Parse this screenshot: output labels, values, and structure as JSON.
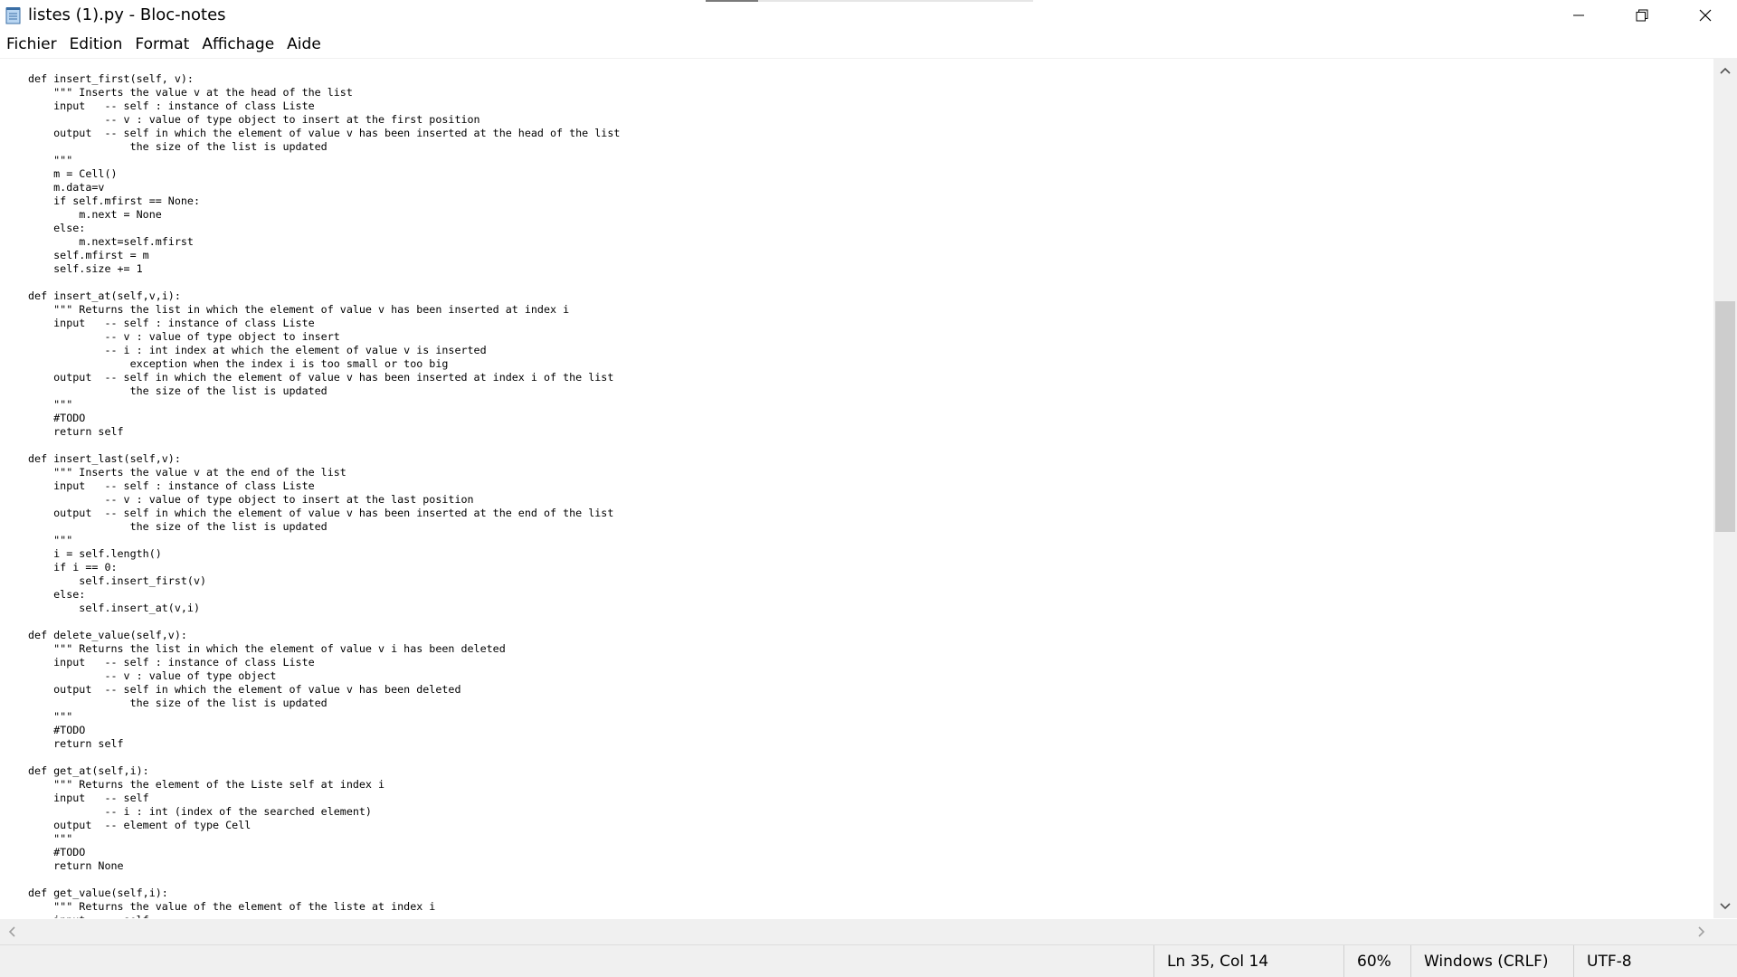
{
  "window": {
    "title": "listes (1).py - Bloc-notes",
    "icon": "notepad-icon",
    "controls": [
      "minimize-icon",
      "restore-icon",
      "close-icon"
    ],
    "loading_progress": 0.16
  },
  "menu": {
    "items": [
      "Fichier",
      "Edition",
      "Format",
      "Affichage",
      "Aide"
    ]
  },
  "editor": {
    "lines": [
      "def insert_first(self, v):",
      "    \"\"\" Inserts the value v at the head of the list",
      "    input   -- self : instance of class Liste",
      "            -- v : value of type object to insert at the first position",
      "    output  -- self in which the element of value v has been inserted at the head of the list",
      "                the size of the list is updated",
      "    \"\"\"",
      "    m = Cell()",
      "    m.data=v",
      "    if self.mfirst == None:",
      "        m.next = None",
      "    else:",
      "        m.next=self.mfirst",
      "    self.mfirst = m",
      "    self.size += 1",
      "",
      "def insert_at(self,v,i):",
      "    \"\"\" Returns the list in which the element of value v has been inserted at index i",
      "    input   -- self : instance of class Liste",
      "            -- v : value of type object to insert",
      "            -- i : int index at which the element of value v is inserted",
      "                exception when the index i is too small or too big",
      "    output  -- self in which the element of value v has been inserted at index i of the list",
      "                the size of the list is updated",
      "    \"\"\"",
      "    #TODO",
      "    return self",
      "",
      "def insert_last(self,v):",
      "    \"\"\" Inserts the value v at the end of the list",
      "    input   -- self : instance of class Liste",
      "            -- v : value of type object to insert at the last position",
      "    output  -- self in which the element of value v has been inserted at the end of the list",
      "                the size of the list is updated",
      "    \"\"\"",
      "    i = self.length()",
      "    if i == 0:",
      "        self.insert_first(v)",
      "    else:",
      "        self.insert_at(v,i)",
      "",
      "def delete_value(self,v):",
      "    \"\"\" Returns the list in which the element of value v i has been deleted",
      "    input   -- self : instance of class Liste",
      "            -- v : value of type object",
      "    output  -- self in which the element of value v has been deleted",
      "                the size of the list is updated",
      "    \"\"\"",
      "    #TODO",
      "    return self",
      "",
      "def get_at(self,i):",
      "    \"\"\" Returns the element of the Liste self at index i",
      "    input   -- self",
      "            -- i : int (index of the searched element)",
      "    output  -- element of type Cell",
      "    \"\"\"",
      "    #TODO",
      "    return None",
      "",
      "def get_value(self,i):",
      "    \"\"\" Returns the value of the element of the liste at index i",
      "    input   -- self"
    ]
  },
  "scrollbars": {
    "vertical_position": 0.3,
    "icons": [
      "chevron-up-icon",
      "chevron-down-icon",
      "chevron-left-icon",
      "chevron-right-icon"
    ]
  },
  "status": {
    "position": "Ln 35, Col 14",
    "zoom": "60%",
    "line_ending": "Windows (CRLF)",
    "encoding": "UTF-8"
  }
}
